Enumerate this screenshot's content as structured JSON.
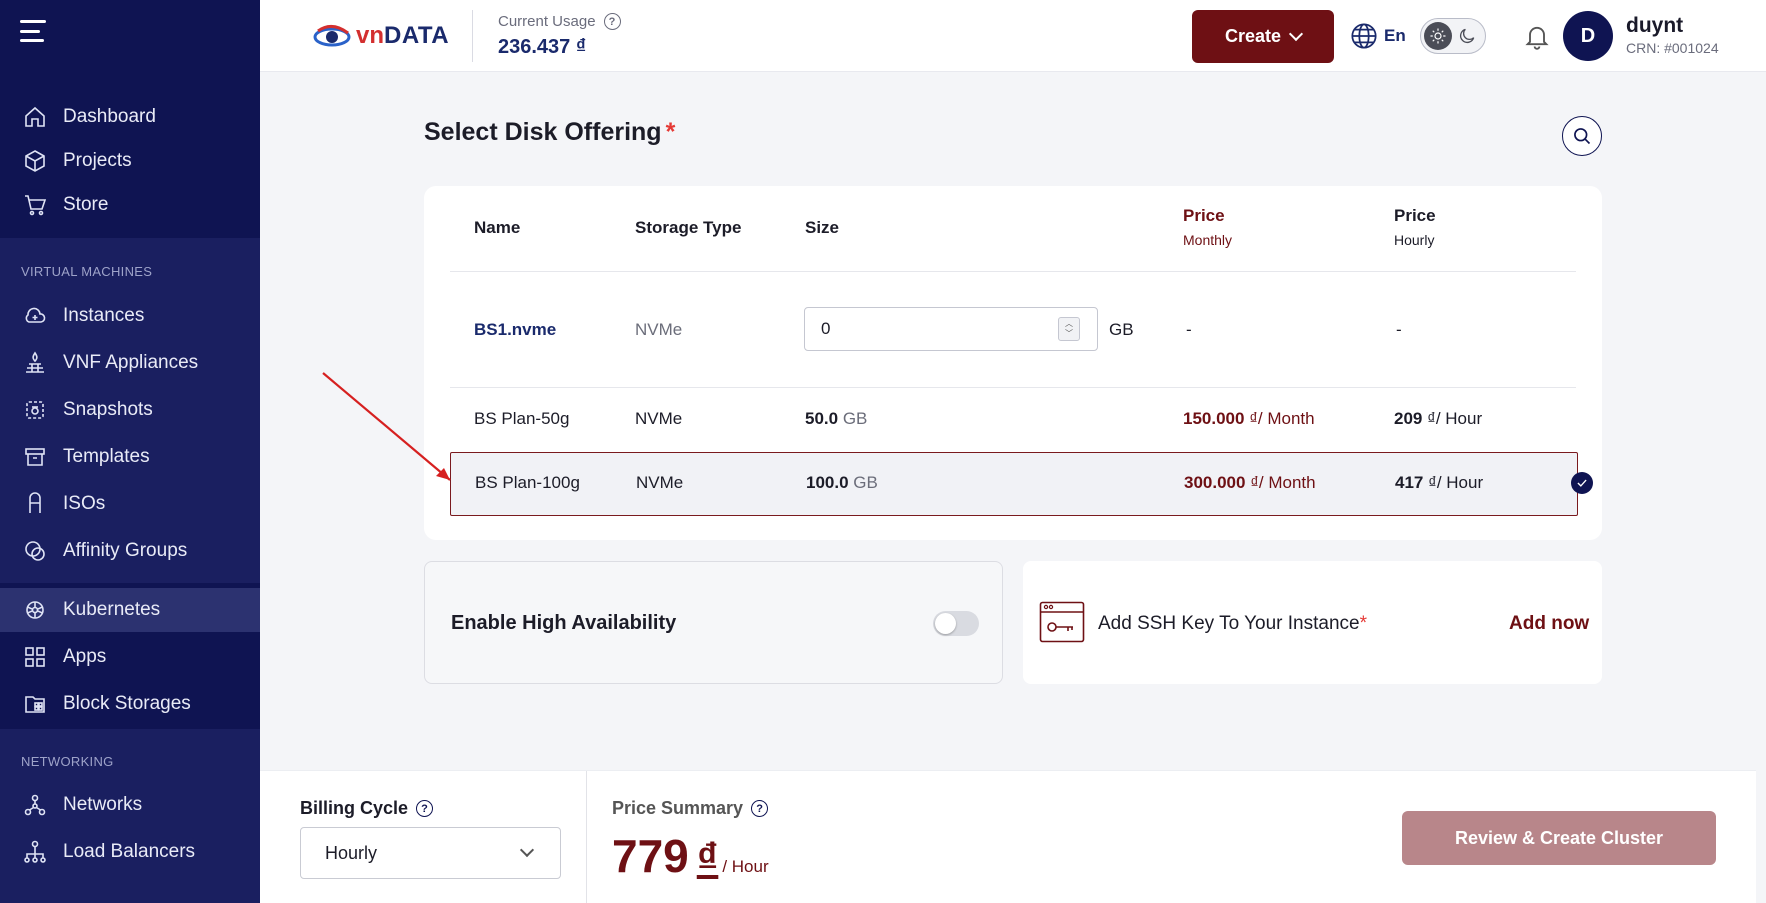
{
  "sidebar": {
    "groups": [
      {
        "heading": "",
        "items": [
          "Dashboard",
          "Projects",
          "Store"
        ]
      },
      {
        "heading": "VIRTUAL MACHINES",
        "items": [
          "Instances",
          "VNF Appliances",
          "Snapshots",
          "Templates",
          "ISOs",
          "Affinity Groups"
        ]
      },
      {
        "heading": "",
        "items": [
          "Kubernetes",
          "Apps",
          "Block Storages"
        ]
      },
      {
        "heading": "NETWORKING",
        "items": [
          "Networks",
          "Load Balancers"
        ]
      }
    ],
    "active_item": "Kubernetes"
  },
  "header": {
    "logo_text_1": "vn",
    "logo_text_2": "DATA",
    "usage_label": "Current Usage",
    "usage_value": "236.437 ₫",
    "create_label": "Create",
    "lang_label": "En",
    "user_initial": "D",
    "user_name": "duynt",
    "user_crn": "CRN: #001024"
  },
  "main": {
    "title": "Select Disk Offering",
    "required_mark": "*",
    "table": {
      "headers": {
        "name": "Name",
        "storage_type": "Storage Type",
        "size": "Size",
        "price_monthly": "Price",
        "price_monthly_sub": "Monthly",
        "price_hourly": "Price",
        "price_hourly_sub": "Hourly"
      },
      "custom_row": {
        "name": "BS1.nvme",
        "storage_type": "NVMe",
        "size_value": "0",
        "size_unit": "GB",
        "price_monthly": "-",
        "price_hourly": "-"
      },
      "rows": [
        {
          "name": "BS Plan-50g",
          "storage_type": "NVMe",
          "size": "50.0",
          "size_unit": "GB",
          "price_monthly": "150.000",
          "monthly_unit": "₫/ Month",
          "price_hourly": "209",
          "hourly_unit": "₫/ Hour"
        },
        {
          "name": "BS Plan-100g",
          "storage_type": "NVMe",
          "size": "100.0",
          "size_unit": "GB",
          "price_monthly": "300.000",
          "monthly_unit": "₫/ Month",
          "price_hourly": "417",
          "hourly_unit": "₫/ Hour"
        }
      ]
    },
    "ha_label": "Enable High Availability",
    "ssh_label": "Add SSH Key To Your Instance",
    "ssh_required": "*",
    "ssh_action": "Add now"
  },
  "footer": {
    "billing_label": "Billing Cycle",
    "billing_value": "Hourly",
    "price_summary_label": "Price Summary",
    "price_value": "779",
    "price_currency": "₫",
    "price_unit": "/ Hour",
    "review_label": "Review & Create Cluster"
  },
  "colors": {
    "sidebar_bg": "#0f1452",
    "accent_dark_red": "#6e1014",
    "review_button": "#b8868a"
  }
}
